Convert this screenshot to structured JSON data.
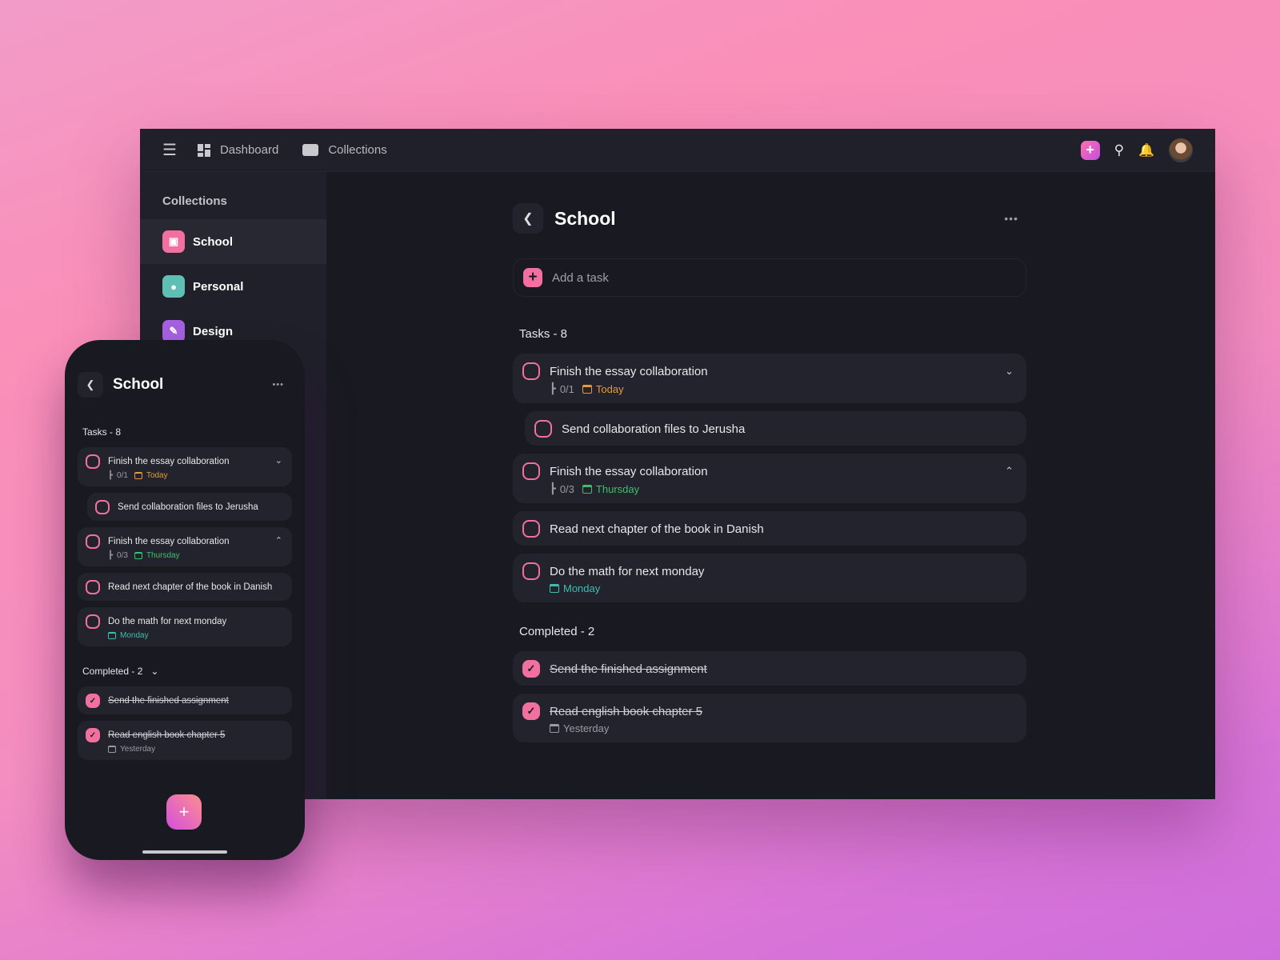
{
  "topbar": {
    "dashboard_label": "Dashboard",
    "collections_label": "Collections"
  },
  "sidebar": {
    "title": "Collections",
    "items": [
      {
        "label": "School",
        "color": "#f2709f",
        "icon": "book-icon"
      },
      {
        "label": "Personal",
        "color": "#5fbfb4",
        "icon": "user-icon"
      },
      {
        "label": "Design",
        "color": "#a561e0",
        "icon": "pencil-icon"
      }
    ]
  },
  "main": {
    "title": "School",
    "add_placeholder": "Add a task",
    "tasks_header": "Tasks - 8",
    "completed_header": "Completed - 2",
    "tasks": [
      {
        "title": "Finish the essay collaboration",
        "subtasks": "0/1",
        "due": "Today",
        "due_color": "#e49a3b",
        "chevron": "down"
      },
      {
        "title": "Send collaboration files to Jerusha",
        "subtask": true
      },
      {
        "title": "Finish the essay collaboration",
        "subtasks": "0/3",
        "due": "Thursday",
        "due_color": "#3fbf6e",
        "chevron": "up"
      },
      {
        "title": "Read next chapter of the book in Danish"
      },
      {
        "title": "Do the math for next monday",
        "due": "Monday",
        "due_color": "#3bbfb2"
      }
    ],
    "completed": [
      {
        "title": "Send the finished assignment"
      },
      {
        "title": "Read english book chapter 5",
        "due": "Yesterday",
        "due_color": "#9a9ba2"
      }
    ]
  }
}
